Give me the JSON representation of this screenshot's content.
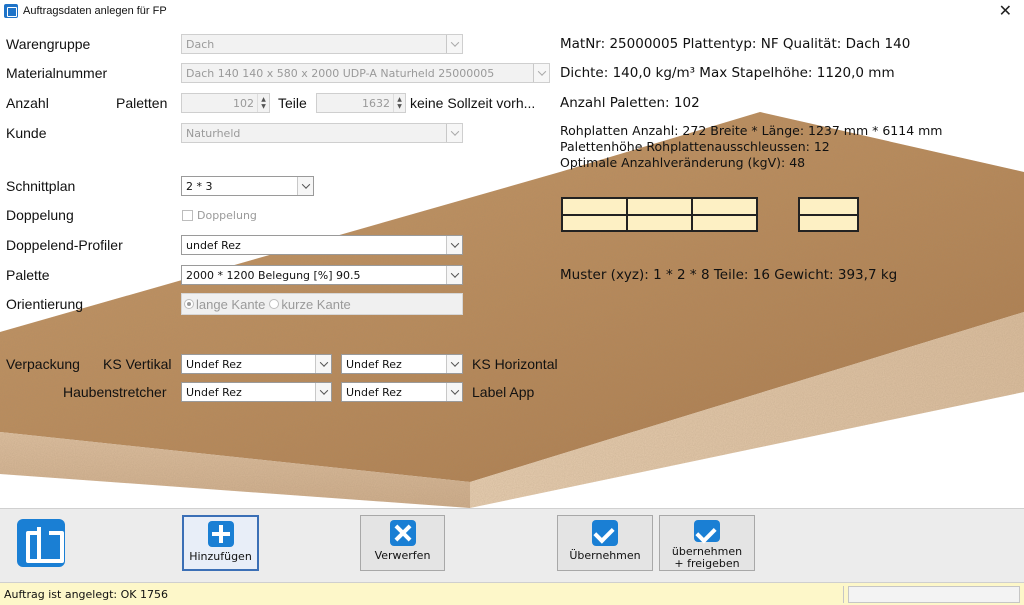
{
  "window": {
    "title": "Auftragsdaten anlegen für FP"
  },
  "form": {
    "warengruppe": {
      "label": "Warengruppe",
      "value": "Dach"
    },
    "materialnummer": {
      "label": "Materialnummer",
      "value": "Dach 140 140 x 580 x 2000 UDP-A Naturheld 25000005"
    },
    "anzahl": {
      "label": "Anzahl",
      "paletten_label": "Paletten",
      "paletten_value": "102",
      "teile_label": "Teile",
      "teile_value": "1632",
      "sollzeit_text": "keine  Sollzeit vorh..."
    },
    "kunde": {
      "label": "Kunde",
      "value": "Naturheld"
    },
    "schnittplan": {
      "label": "Schnittplan",
      "value": "2 * 3"
    },
    "doppelung": {
      "label": "Doppelung",
      "checkbox_label": "Doppelung"
    },
    "doppelend_profiler": {
      "label": "Doppelend-Profiler",
      "value": "undef Rez"
    },
    "palette": {
      "label": "Palette",
      "value": "2000 * 1200 Belegung [%] 90.5"
    },
    "orientierung": {
      "label": "Orientierung",
      "option_long": "lange Kante",
      "option_short": "kurze Kante",
      "selected": "lange Kante"
    },
    "verpackung": {
      "label": "Verpackung",
      "ks_vertikal_label": "KS Vertikal",
      "ks_vertikal_value": "Undef Rez",
      "ks_horizontal_value": "Undef Rez",
      "ks_horizontal_label": "KS Horizontal",
      "haubenstretcher_label": "Haubenstretcher",
      "haubenstretcher_value": "Undef Rez",
      "label_app_value": "Undef Rez",
      "label_app_label": "Label App"
    }
  },
  "info": {
    "line1": "MatNr: 25000005 Plattentyp: NF Qualität: Dach 140",
    "line2": "Dichte: 140,0 kg/m³   Max Stapelhöhe: 1120,0 mm",
    "line3": "Anzahl Paletten: 102",
    "line4": "Rohplatten Anzahl: 272 Breite * Länge: 1237 mm * 6114 mm",
    "line5": "Palettenhöhe Rohplattenausschleussen: 12",
    "line6": "Optimale Anzahlveränderung (kgV): 48",
    "muster": "Muster (xyz): 1 * 2 * 8 Teile: 16 Gewicht: 393,7 kg"
  },
  "toolbar": {
    "add_label": "Hinzufügen",
    "discard_label": "Verwerfen",
    "apply_label": "Übernehmen",
    "apply_release_label_1": "übernehmen",
    "apply_release_label_2": "+ freigeben"
  },
  "status": {
    "message": "Auftrag ist angelegt: OK 1756"
  },
  "colors": {
    "accent": "#1a7fd4",
    "status_bg": "#fdf7c9",
    "pattern_fill": "#fdf0c4"
  }
}
